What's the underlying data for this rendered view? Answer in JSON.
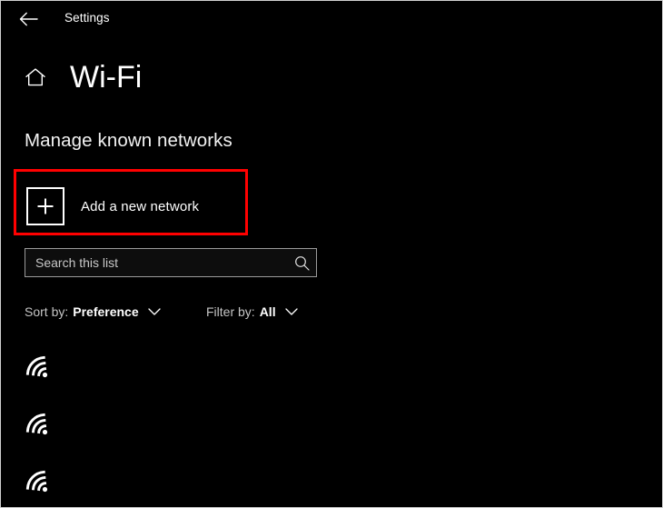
{
  "window": {
    "background_color": "#000000",
    "text_color": "#ffffff"
  },
  "titlebar": {
    "back_icon": "back-arrow-icon",
    "title": "Settings"
  },
  "page_header": {
    "home_icon": "home-icon",
    "title": "Wi-Fi"
  },
  "section": {
    "heading": "Manage known networks"
  },
  "annotation": {
    "highlight_color": "#ff0000",
    "target": "add-a-new-network-row"
  },
  "add_network": {
    "icon": "plus-icon",
    "label": "Add a new network"
  },
  "search": {
    "placeholder": "Search this list",
    "value": "",
    "icon": "search-icon"
  },
  "controls": {
    "sort": {
      "prefix": "Sort by:",
      "value": "Preference",
      "chevron": "chevron-down-icon"
    },
    "filter": {
      "prefix": "Filter by:",
      "value": "All",
      "chevron": "chevron-down-icon"
    }
  },
  "networks": [
    {
      "icon": "wifi-signal-icon",
      "name": ""
    },
    {
      "icon": "wifi-signal-icon",
      "name": ""
    },
    {
      "icon": "wifi-signal-icon",
      "name": ""
    }
  ]
}
